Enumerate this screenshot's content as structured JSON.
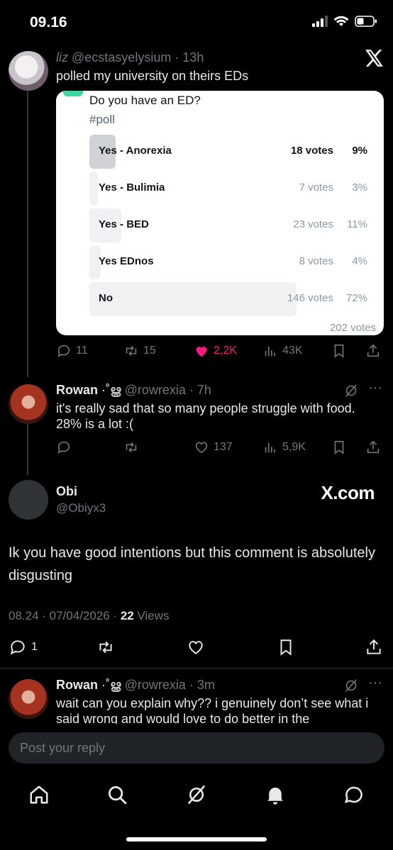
{
  "status_bar": {
    "time": "09.16"
  },
  "thread": [
    {
      "display_name": "liz",
      "handle": "@ecstasyelysium",
      "time": "13h",
      "text": "polled my university on theirs EDs",
      "poll": {
        "question": "Do you have an ED?",
        "tag": "#poll",
        "options": [
          {
            "label": "Yes - Anorexia",
            "votes": "18 votes",
            "pct": "9%",
            "fraction": 0.09,
            "leading": true
          },
          {
            "label": "Yes - Bulimia",
            "votes": "7 votes",
            "pct": "3%",
            "fraction": 0.03,
            "leading": false
          },
          {
            "label": "Yes - BED",
            "votes": "23 votes",
            "pct": "11%",
            "fraction": 0.11,
            "leading": false
          },
          {
            "label": "Yes EDnos",
            "votes": "8 votes",
            "pct": "4%",
            "fraction": 0.04,
            "leading": false
          },
          {
            "label": "No",
            "votes": "146 votes",
            "pct": "72%",
            "fraction": 0.72,
            "leading": false
          }
        ],
        "total": "202 votes"
      },
      "stats": {
        "replies": "11",
        "reposts": "15",
        "likes": "2,2K",
        "views": "43K"
      }
    },
    {
      "display_name": "Rowan",
      "badge": "·˚ൠ",
      "handle": "@rowrexia",
      "time": "7h",
      "text": "it's really sad that so many people struggle with food. 28% is a lot :(",
      "stats": {
        "replies": "",
        "reposts": "",
        "likes": "137",
        "views": "5,9K"
      }
    }
  ],
  "focused": {
    "display_name": "Obi",
    "handle": "@Obiyx3",
    "watermark": "X.com",
    "text": "Ik you have good intentions but this comment is absolutely disgusting",
    "timestamp": "08.24 · 07/04/2026 · ",
    "views_count": "22",
    "views_label": " Views",
    "replies": "1"
  },
  "reply": {
    "display_name": "Rowan",
    "badge": "·˚ൠ",
    "handle": "@rowrexia",
    "time": "3m",
    "text": "wait can you explain why?? i genuinely don’t see what i said wrong and would love to do better in the"
  },
  "composer": {
    "placeholder": "Post your reply"
  },
  "colors": {
    "like_active": "#f91880",
    "poll_lead": "#cfd3d7",
    "poll_bar": "#eff1f3",
    "accent_tab": "#3ed6a4"
  }
}
